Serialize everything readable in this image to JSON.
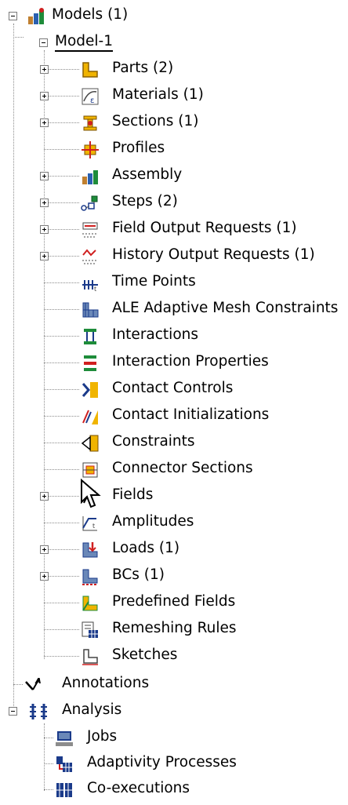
{
  "tree": {
    "models": {
      "label": "Models (1)",
      "icon": "models-icon",
      "expanded": true
    },
    "model1": {
      "label": "Model-1",
      "expanded": true,
      "selected": true
    },
    "children": [
      {
        "name": "parts",
        "label": "Parts (2)",
        "icon": "parts-icon",
        "expandable": true
      },
      {
        "name": "materials",
        "label": "Materials (1)",
        "icon": "materials-icon",
        "expandable": true
      },
      {
        "name": "sections",
        "label": "Sections (1)",
        "icon": "sections-icon",
        "expandable": true
      },
      {
        "name": "profiles",
        "label": "Profiles",
        "icon": "profiles-icon",
        "expandable": false
      },
      {
        "name": "assembly",
        "label": "Assembly",
        "icon": "assembly-icon",
        "expandable": true
      },
      {
        "name": "steps",
        "label": "Steps (2)",
        "icon": "steps-icon",
        "expandable": true
      },
      {
        "name": "field-output-requests",
        "label": "Field Output Requests (1)",
        "icon": "field-output-icon",
        "expandable": true
      },
      {
        "name": "history-output-requests",
        "label": "History Output Requests (1)",
        "icon": "history-output-icon",
        "expandable": true
      },
      {
        "name": "time-points",
        "label": "Time Points",
        "icon": "time-points-icon",
        "expandable": false
      },
      {
        "name": "ale-adaptive-mesh-constraints",
        "label": "ALE Adaptive Mesh Constraints",
        "icon": "ale-mesh-icon",
        "expandable": false
      },
      {
        "name": "interactions",
        "label": "Interactions",
        "icon": "interactions-icon",
        "expandable": false
      },
      {
        "name": "interaction-properties",
        "label": "Interaction Properties",
        "icon": "interaction-properties-icon",
        "expandable": false
      },
      {
        "name": "contact-controls",
        "label": "Contact Controls",
        "icon": "contact-controls-icon",
        "expandable": false
      },
      {
        "name": "contact-initializations",
        "label": "Contact Initializations",
        "icon": "contact-initializations-icon",
        "expandable": false
      },
      {
        "name": "constraints",
        "label": "Constraints",
        "icon": "constraints-icon",
        "expandable": false
      },
      {
        "name": "connector-sections",
        "label": "Connector Sections",
        "icon": "connector-sections-icon",
        "expandable": false
      },
      {
        "name": "fields",
        "label": "Fields",
        "icon": "fields-icon",
        "expandable": true
      },
      {
        "name": "amplitudes",
        "label": "Amplitudes",
        "icon": "amplitudes-icon",
        "expandable": false
      },
      {
        "name": "loads",
        "label": "Loads (1)",
        "icon": "loads-icon",
        "expandable": true
      },
      {
        "name": "bcs",
        "label": "BCs (1)",
        "icon": "bcs-icon",
        "expandable": true
      },
      {
        "name": "predefined-fields",
        "label": "Predefined Fields",
        "icon": "predefined-fields-icon",
        "expandable": false
      },
      {
        "name": "remeshing-rules",
        "label": "Remeshing Rules",
        "icon": "remeshing-rules-icon",
        "expandable": false
      },
      {
        "name": "sketches",
        "label": "Sketches",
        "icon": "sketches-icon",
        "expandable": false
      }
    ],
    "annotations": {
      "label": "Annotations",
      "icon": "annotations-icon"
    },
    "analysis": {
      "label": "Analysis",
      "icon": "analysis-icon",
      "expanded": true
    },
    "analysis_children": [
      {
        "name": "jobs",
        "label": "Jobs",
        "icon": "jobs-icon"
      },
      {
        "name": "adaptivity-processes",
        "label": "Adaptivity Processes",
        "icon": "adaptivity-processes-icon"
      },
      {
        "name": "co-executions",
        "label": "Co-executions",
        "icon": "co-executions-icon"
      }
    ]
  },
  "colors": {
    "tree_line": "#8c8c8c",
    "background": "#ffffff",
    "icon_yellow": "#f0b400",
    "icon_red": "#d02020",
    "icon_blue": "#1a3a8a"
  }
}
